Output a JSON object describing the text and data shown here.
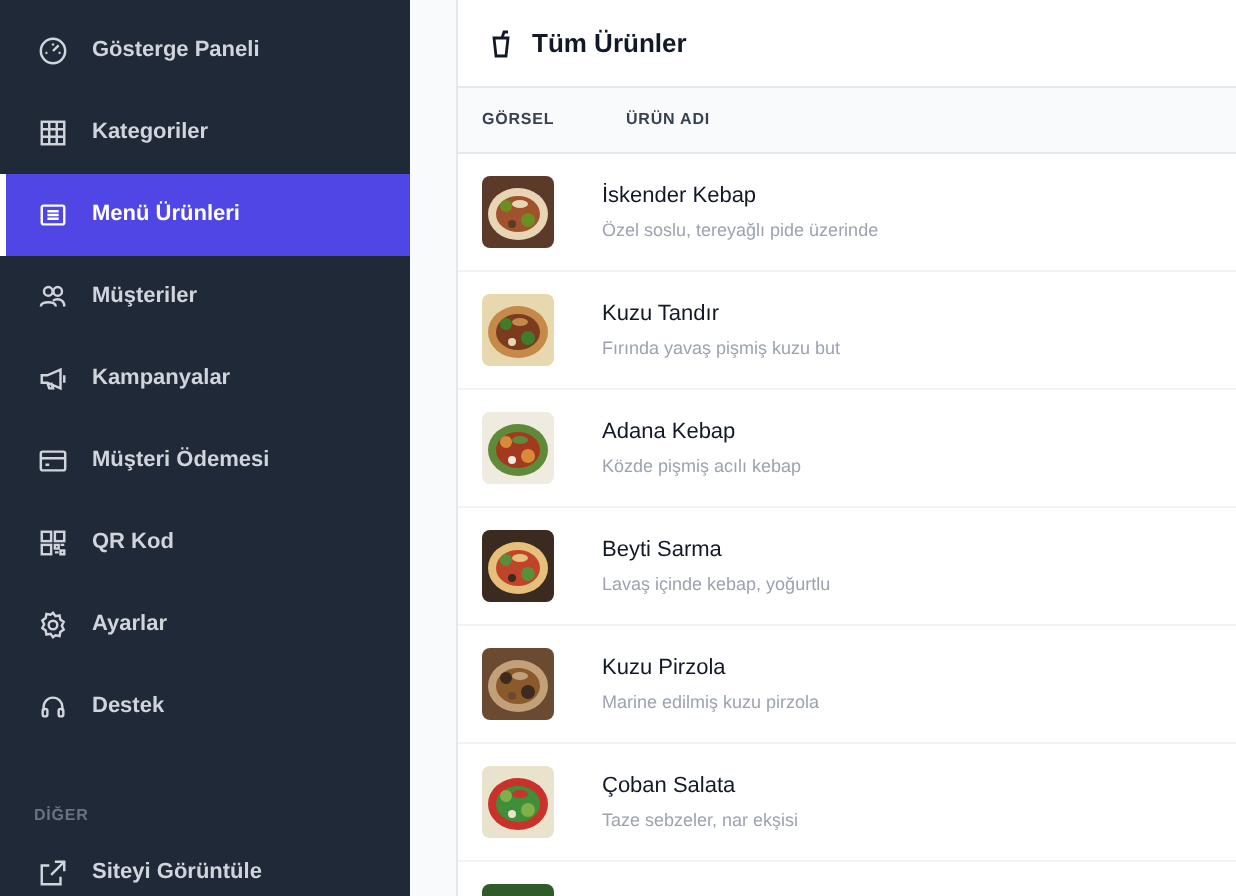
{
  "sidebar": {
    "items": [
      {
        "label": "Gösterge Paneli",
        "kind": "gauge",
        "selected": false
      },
      {
        "label": "Kategoriler",
        "kind": "grid",
        "selected": false
      },
      {
        "label": "Menü Ürünleri",
        "kind": "list",
        "selected": true
      },
      {
        "label": "Müşteriler",
        "kind": "users",
        "selected": false
      },
      {
        "label": "Kampanyalar",
        "kind": "megaphone",
        "selected": false
      },
      {
        "label": "Müşteri Ödemesi",
        "kind": "card",
        "selected": false
      },
      {
        "label": "QR Kod",
        "kind": "qr",
        "selected": false
      },
      {
        "label": "Ayarlar",
        "kind": "gear",
        "selected": false
      },
      {
        "label": "Destek",
        "kind": "headset",
        "selected": false
      }
    ],
    "section": {
      "heading": "DİĞER",
      "items": [
        {
          "label": "Siteyi Görüntüle",
          "kind": "external",
          "selected": false
        }
      ]
    }
  },
  "panel": {
    "title": "Tüm Ürünler",
    "table": {
      "columns": [
        "GÖRSEL",
        "ÜRÜN ADI"
      ],
      "rows": [
        {
          "image": {
            "kind": "picture"
          },
          "name": "İskender Kebap",
          "description": "Özel soslu, tereyağlı pide üzerinde"
        },
        {
          "image": {
            "kind": "picture"
          },
          "name": "Kuzu Tandır",
          "description": "Fırında yavaş pişmiş kuzu but"
        },
        {
          "image": {
            "kind": "picture"
          },
          "name": "Adana Kebap",
          "description": "Közde pişmiş acılı kebap"
        },
        {
          "image": {
            "kind": "picture"
          },
          "name": "Beyti Sarma",
          "description": "Lavaş içinde kebap, yoğurtlu"
        },
        {
          "image": {
            "kind": "picture"
          },
          "name": "Kuzu Pirzola",
          "description": "Marine edilmiş kuzu pirzola"
        },
        {
          "image": {
            "kind": "picture"
          },
          "name": "Çoban Salata",
          "description": "Taze sebzeler, nar ekşisi"
        },
        {
          "image": {
            "kind": "picture"
          }
        }
      ]
    }
  }
}
